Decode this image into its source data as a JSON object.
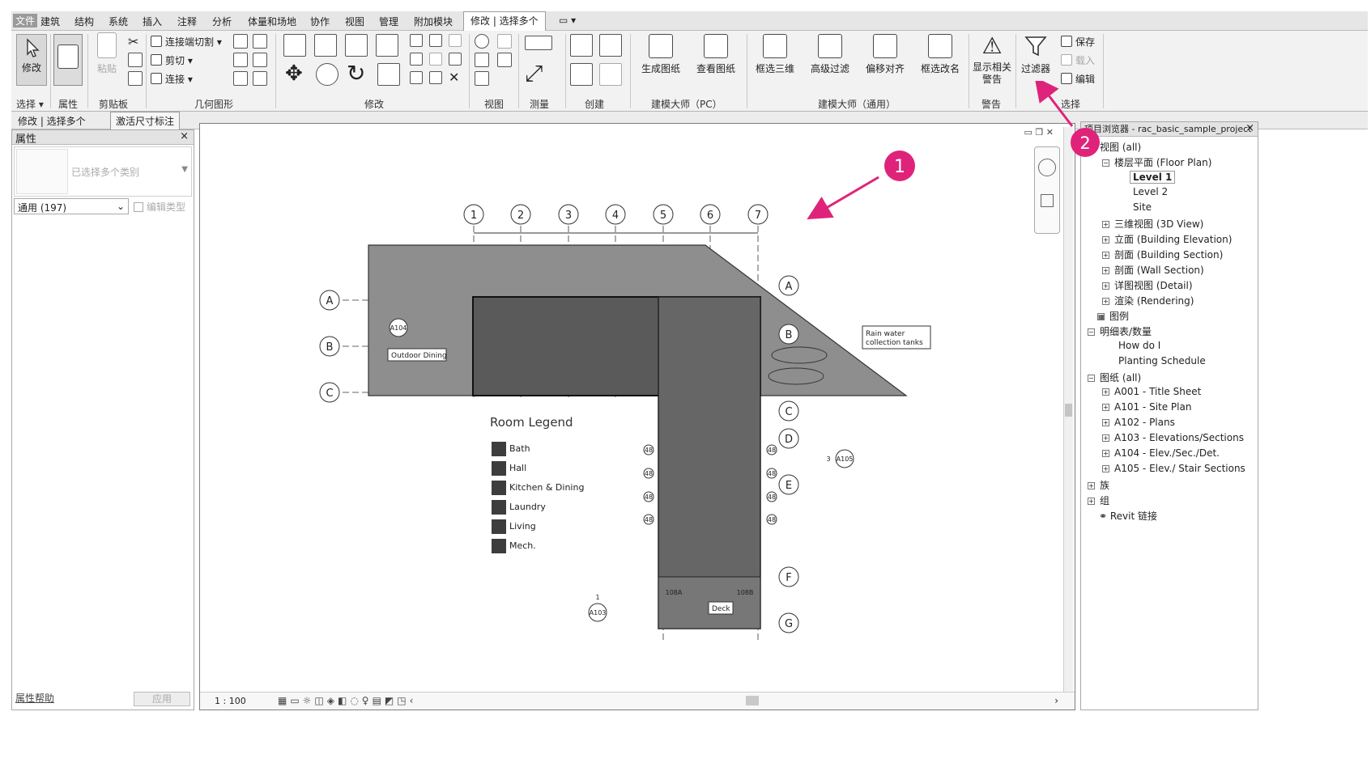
{
  "menu": {
    "file": "文件",
    "items": [
      "建筑",
      "结构",
      "系统",
      "插入",
      "注释",
      "分析",
      "体量和场地",
      "协作",
      "视图",
      "管理",
      "附加模块"
    ],
    "active_tab": "修改 | 选择多个",
    "extra": "▭ ▾"
  },
  "ribbon": {
    "modify": "修改",
    "paste": "粘贴",
    "cut_join": "连接端切割",
    "cut": "剪切",
    "join": "连接",
    "gen_sheet": "生成图纸",
    "view_sheet": "查看图纸",
    "select_3d": "框选三维",
    "adv_filter": "高级过滤",
    "offset_align": "偏移对齐",
    "rename": "框选改名",
    "show_warn_1": "显示相关",
    "show_warn_2": "警告",
    "filter": "过滤器",
    "save": "保存",
    "load": "载入",
    "edit": "编辑",
    "panels": {
      "select": "选择",
      "props": "属性",
      "clipboard": "剪贴板",
      "geometry": "几何图形",
      "modify": "修改",
      "view": "视图",
      "measure": "测量",
      "create": "创建",
      "bim_pc": "建模大师（PC）",
      "bim_general": "建模大师（通用）",
      "warning": "警告",
      "selection": "选择"
    }
  },
  "ctx": {
    "label": "修改 | 选择多个",
    "button": "激活尺寸标注"
  },
  "properties": {
    "title": "属性",
    "close": "×",
    "type_placeholder": "已选择多个类别",
    "filter_value": "通用 (197)",
    "edit_type": "编辑类型",
    "help": "属性帮助",
    "apply": "应用"
  },
  "browser": {
    "title": "项目浏览器 - rac_basic_sample_project",
    "close": "×",
    "items": {
      "views": "视图 (all)",
      "floor_plan": "楼层平面 (Floor Plan)",
      "level1": "Level 1",
      "level2": "Level 2",
      "site": "Site",
      "view3d": "三维视图 (3D View)",
      "elevation": "立面 (Building Elevation)",
      "section": "剖面 (Building Section)",
      "wall_section": "剖面 (Wall Section)",
      "detail": "详图视图 (Detail)",
      "render": "渲染 (Rendering)",
      "legend": "图例",
      "schedules": "明细表/数量",
      "how": "How do I",
      "planting": "Planting Schedule",
      "sheets": "图纸 (all)",
      "a001": "A001 - Title Sheet",
      "a101": "A101 - Site Plan",
      "a102": "A102 - Plans",
      "a103": "A103 - Elevations/Sections",
      "a104": "A104 - Elev./Sec./Det.",
      "a105": "A105 - Elev./ Stair Sections",
      "families": "族",
      "groups": "组",
      "revit_links": "Revit 链接"
    }
  },
  "drawing": {
    "grids_top": [
      "1",
      "2",
      "3",
      "4",
      "5",
      "6",
      "7"
    ],
    "grids_side": [
      "A",
      "B",
      "C",
      "D",
      "E",
      "F",
      "G"
    ],
    "grids_left": [
      "A",
      "B",
      "C"
    ],
    "outdoor_dining": "Outdoor Dining",
    "rain_water_1": "Rain water",
    "rain_water_2": "collection tanks",
    "deck": "Deck",
    "legend_title": "Room Legend",
    "legend_items": [
      "Bath",
      "Hall",
      "Kitchen & Dining",
      "Laundry",
      "Living",
      "Mech."
    ],
    "tag_48": "48",
    "tag_a104": "A104",
    "tag_a105": "A105",
    "tag_a103": "A103",
    "tag_3": "3",
    "tag_108a": "108A",
    "tag_108b": "108B",
    "tag_1": "1"
  },
  "statusbar": {
    "scale": "1 : 100"
  },
  "callouts": {
    "one": "1",
    "two": "2"
  },
  "colors": {
    "accent": "#e0237a",
    "building_light": "#8a8a8a",
    "building_dark": "#555555",
    "legend_swatch": "#3d3d3d"
  }
}
